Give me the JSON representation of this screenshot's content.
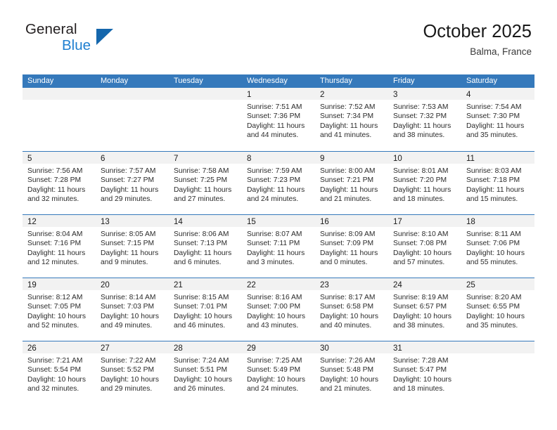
{
  "brand": {
    "line1": "General",
    "line2": "Blue",
    "mark": "triangle-logo"
  },
  "header": {
    "title": "October 2025",
    "location": "Balma, France"
  },
  "colors": {
    "header_blue": "#3579bb",
    "brand_blue": "#1f7fd0",
    "mark_blue": "#1567ad",
    "day_band": "#f2f2f2"
  },
  "calendar": {
    "day_names": [
      "Sunday",
      "Monday",
      "Tuesday",
      "Wednesday",
      "Thursday",
      "Friday",
      "Saturday"
    ],
    "weeks": [
      [
        {
          "blank": true
        },
        {
          "blank": true
        },
        {
          "blank": true
        },
        {
          "day": "1",
          "sunrise": "Sunrise: 7:51 AM",
          "sunset": "Sunset: 7:36 PM",
          "daylight_1": "Daylight: 11 hours",
          "daylight_2": "and 44 minutes."
        },
        {
          "day": "2",
          "sunrise": "Sunrise: 7:52 AM",
          "sunset": "Sunset: 7:34 PM",
          "daylight_1": "Daylight: 11 hours",
          "daylight_2": "and 41 minutes."
        },
        {
          "day": "3",
          "sunrise": "Sunrise: 7:53 AM",
          "sunset": "Sunset: 7:32 PM",
          "daylight_1": "Daylight: 11 hours",
          "daylight_2": "and 38 minutes."
        },
        {
          "day": "4",
          "sunrise": "Sunrise: 7:54 AM",
          "sunset": "Sunset: 7:30 PM",
          "daylight_1": "Daylight: 11 hours",
          "daylight_2": "and 35 minutes."
        }
      ],
      [
        {
          "day": "5",
          "sunrise": "Sunrise: 7:56 AM",
          "sunset": "Sunset: 7:28 PM",
          "daylight_1": "Daylight: 11 hours",
          "daylight_2": "and 32 minutes."
        },
        {
          "day": "6",
          "sunrise": "Sunrise: 7:57 AM",
          "sunset": "Sunset: 7:27 PM",
          "daylight_1": "Daylight: 11 hours",
          "daylight_2": "and 29 minutes."
        },
        {
          "day": "7",
          "sunrise": "Sunrise: 7:58 AM",
          "sunset": "Sunset: 7:25 PM",
          "daylight_1": "Daylight: 11 hours",
          "daylight_2": "and 27 minutes."
        },
        {
          "day": "8",
          "sunrise": "Sunrise: 7:59 AM",
          "sunset": "Sunset: 7:23 PM",
          "daylight_1": "Daylight: 11 hours",
          "daylight_2": "and 24 minutes."
        },
        {
          "day": "9",
          "sunrise": "Sunrise: 8:00 AM",
          "sunset": "Sunset: 7:21 PM",
          "daylight_1": "Daylight: 11 hours",
          "daylight_2": "and 21 minutes."
        },
        {
          "day": "10",
          "sunrise": "Sunrise: 8:01 AM",
          "sunset": "Sunset: 7:20 PM",
          "daylight_1": "Daylight: 11 hours",
          "daylight_2": "and 18 minutes."
        },
        {
          "day": "11",
          "sunrise": "Sunrise: 8:03 AM",
          "sunset": "Sunset: 7:18 PM",
          "daylight_1": "Daylight: 11 hours",
          "daylight_2": "and 15 minutes."
        }
      ],
      [
        {
          "day": "12",
          "sunrise": "Sunrise: 8:04 AM",
          "sunset": "Sunset: 7:16 PM",
          "daylight_1": "Daylight: 11 hours",
          "daylight_2": "and 12 minutes."
        },
        {
          "day": "13",
          "sunrise": "Sunrise: 8:05 AM",
          "sunset": "Sunset: 7:15 PM",
          "daylight_1": "Daylight: 11 hours",
          "daylight_2": "and 9 minutes."
        },
        {
          "day": "14",
          "sunrise": "Sunrise: 8:06 AM",
          "sunset": "Sunset: 7:13 PM",
          "daylight_1": "Daylight: 11 hours",
          "daylight_2": "and 6 minutes."
        },
        {
          "day": "15",
          "sunrise": "Sunrise: 8:07 AM",
          "sunset": "Sunset: 7:11 PM",
          "daylight_1": "Daylight: 11 hours",
          "daylight_2": "and 3 minutes."
        },
        {
          "day": "16",
          "sunrise": "Sunrise: 8:09 AM",
          "sunset": "Sunset: 7:09 PM",
          "daylight_1": "Daylight: 11 hours",
          "daylight_2": "and 0 minutes."
        },
        {
          "day": "17",
          "sunrise": "Sunrise: 8:10 AM",
          "sunset": "Sunset: 7:08 PM",
          "daylight_1": "Daylight: 10 hours",
          "daylight_2": "and 57 minutes."
        },
        {
          "day": "18",
          "sunrise": "Sunrise: 8:11 AM",
          "sunset": "Sunset: 7:06 PM",
          "daylight_1": "Daylight: 10 hours",
          "daylight_2": "and 55 minutes."
        }
      ],
      [
        {
          "day": "19",
          "sunrise": "Sunrise: 8:12 AM",
          "sunset": "Sunset: 7:05 PM",
          "daylight_1": "Daylight: 10 hours",
          "daylight_2": "and 52 minutes."
        },
        {
          "day": "20",
          "sunrise": "Sunrise: 8:14 AM",
          "sunset": "Sunset: 7:03 PM",
          "daylight_1": "Daylight: 10 hours",
          "daylight_2": "and 49 minutes."
        },
        {
          "day": "21",
          "sunrise": "Sunrise: 8:15 AM",
          "sunset": "Sunset: 7:01 PM",
          "daylight_1": "Daylight: 10 hours",
          "daylight_2": "and 46 minutes."
        },
        {
          "day": "22",
          "sunrise": "Sunrise: 8:16 AM",
          "sunset": "Sunset: 7:00 PM",
          "daylight_1": "Daylight: 10 hours",
          "daylight_2": "and 43 minutes."
        },
        {
          "day": "23",
          "sunrise": "Sunrise: 8:17 AM",
          "sunset": "Sunset: 6:58 PM",
          "daylight_1": "Daylight: 10 hours",
          "daylight_2": "and 40 minutes."
        },
        {
          "day": "24",
          "sunrise": "Sunrise: 8:19 AM",
          "sunset": "Sunset: 6:57 PM",
          "daylight_1": "Daylight: 10 hours",
          "daylight_2": "and 38 minutes."
        },
        {
          "day": "25",
          "sunrise": "Sunrise: 8:20 AM",
          "sunset": "Sunset: 6:55 PM",
          "daylight_1": "Daylight: 10 hours",
          "daylight_2": "and 35 minutes."
        }
      ],
      [
        {
          "day": "26",
          "sunrise": "Sunrise: 7:21 AM",
          "sunset": "Sunset: 5:54 PM",
          "daylight_1": "Daylight: 10 hours",
          "daylight_2": "and 32 minutes."
        },
        {
          "day": "27",
          "sunrise": "Sunrise: 7:22 AM",
          "sunset": "Sunset: 5:52 PM",
          "daylight_1": "Daylight: 10 hours",
          "daylight_2": "and 29 minutes."
        },
        {
          "day": "28",
          "sunrise": "Sunrise: 7:24 AM",
          "sunset": "Sunset: 5:51 PM",
          "daylight_1": "Daylight: 10 hours",
          "daylight_2": "and 26 minutes."
        },
        {
          "day": "29",
          "sunrise": "Sunrise: 7:25 AM",
          "sunset": "Sunset: 5:49 PM",
          "daylight_1": "Daylight: 10 hours",
          "daylight_2": "and 24 minutes."
        },
        {
          "day": "30",
          "sunrise": "Sunrise: 7:26 AM",
          "sunset": "Sunset: 5:48 PM",
          "daylight_1": "Daylight: 10 hours",
          "daylight_2": "and 21 minutes."
        },
        {
          "day": "31",
          "sunrise": "Sunrise: 7:28 AM",
          "sunset": "Sunset: 5:47 PM",
          "daylight_1": "Daylight: 10 hours",
          "daylight_2": "and 18 minutes."
        },
        {
          "blank": true
        }
      ]
    ]
  }
}
